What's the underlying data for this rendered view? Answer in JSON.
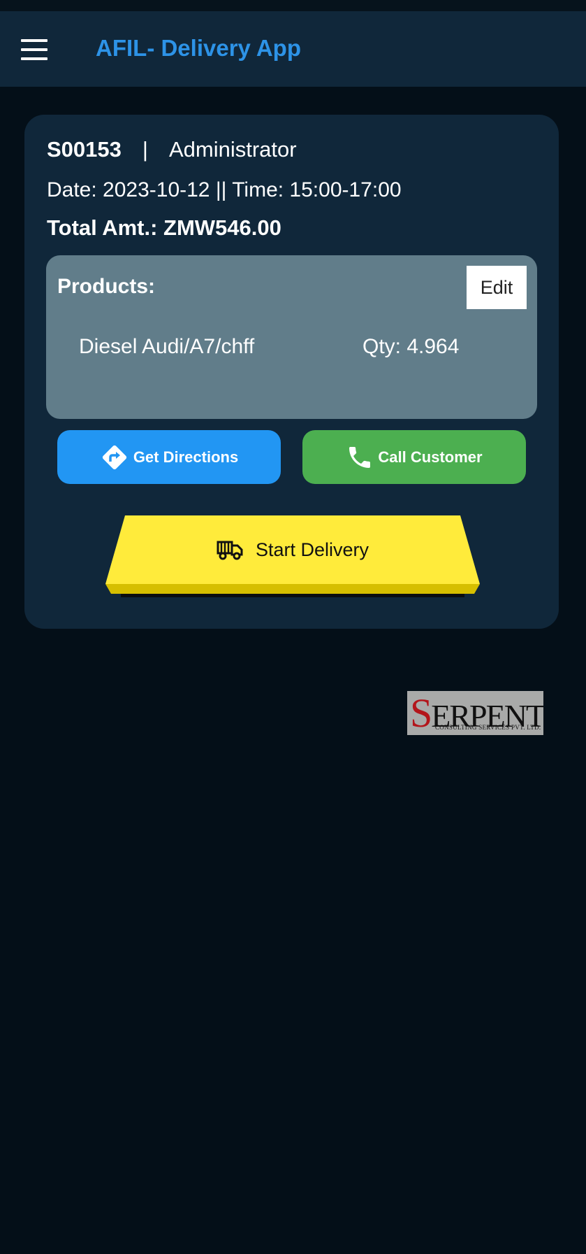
{
  "app_bar": {
    "title": "AFIL- Delivery App",
    "menu_icon": "hamburger-menu-icon",
    "title_color": "#2d93e7",
    "background": "#10273a"
  },
  "order": {
    "id": "S00153",
    "separator": "|",
    "user": "Administrator",
    "datetime": "Date: 2023-10-12  || Time: 15:00-17:00",
    "total": "Total Amt.: ZMW546.00"
  },
  "products": {
    "title": "Products:",
    "edit_label": "Edit",
    "items": [
      {
        "name": "Diesel Audi/A7/chff",
        "qty": "Qty: 4.964"
      }
    ]
  },
  "actions": {
    "directions_label": "Get Directions",
    "directions_icon": "directions-icon",
    "directions_color": "#2296f3",
    "call_label": "Call Customer",
    "call_icon": "phone-icon",
    "call_color": "#4caf50",
    "start_label": "Start Delivery",
    "start_icon": "delivery-truck-icon",
    "start_color": "#ffeb3b"
  },
  "logo": {
    "text": "SERPENT",
    "subtext": "CONSULTING SERVICES PVT. LTD."
  }
}
